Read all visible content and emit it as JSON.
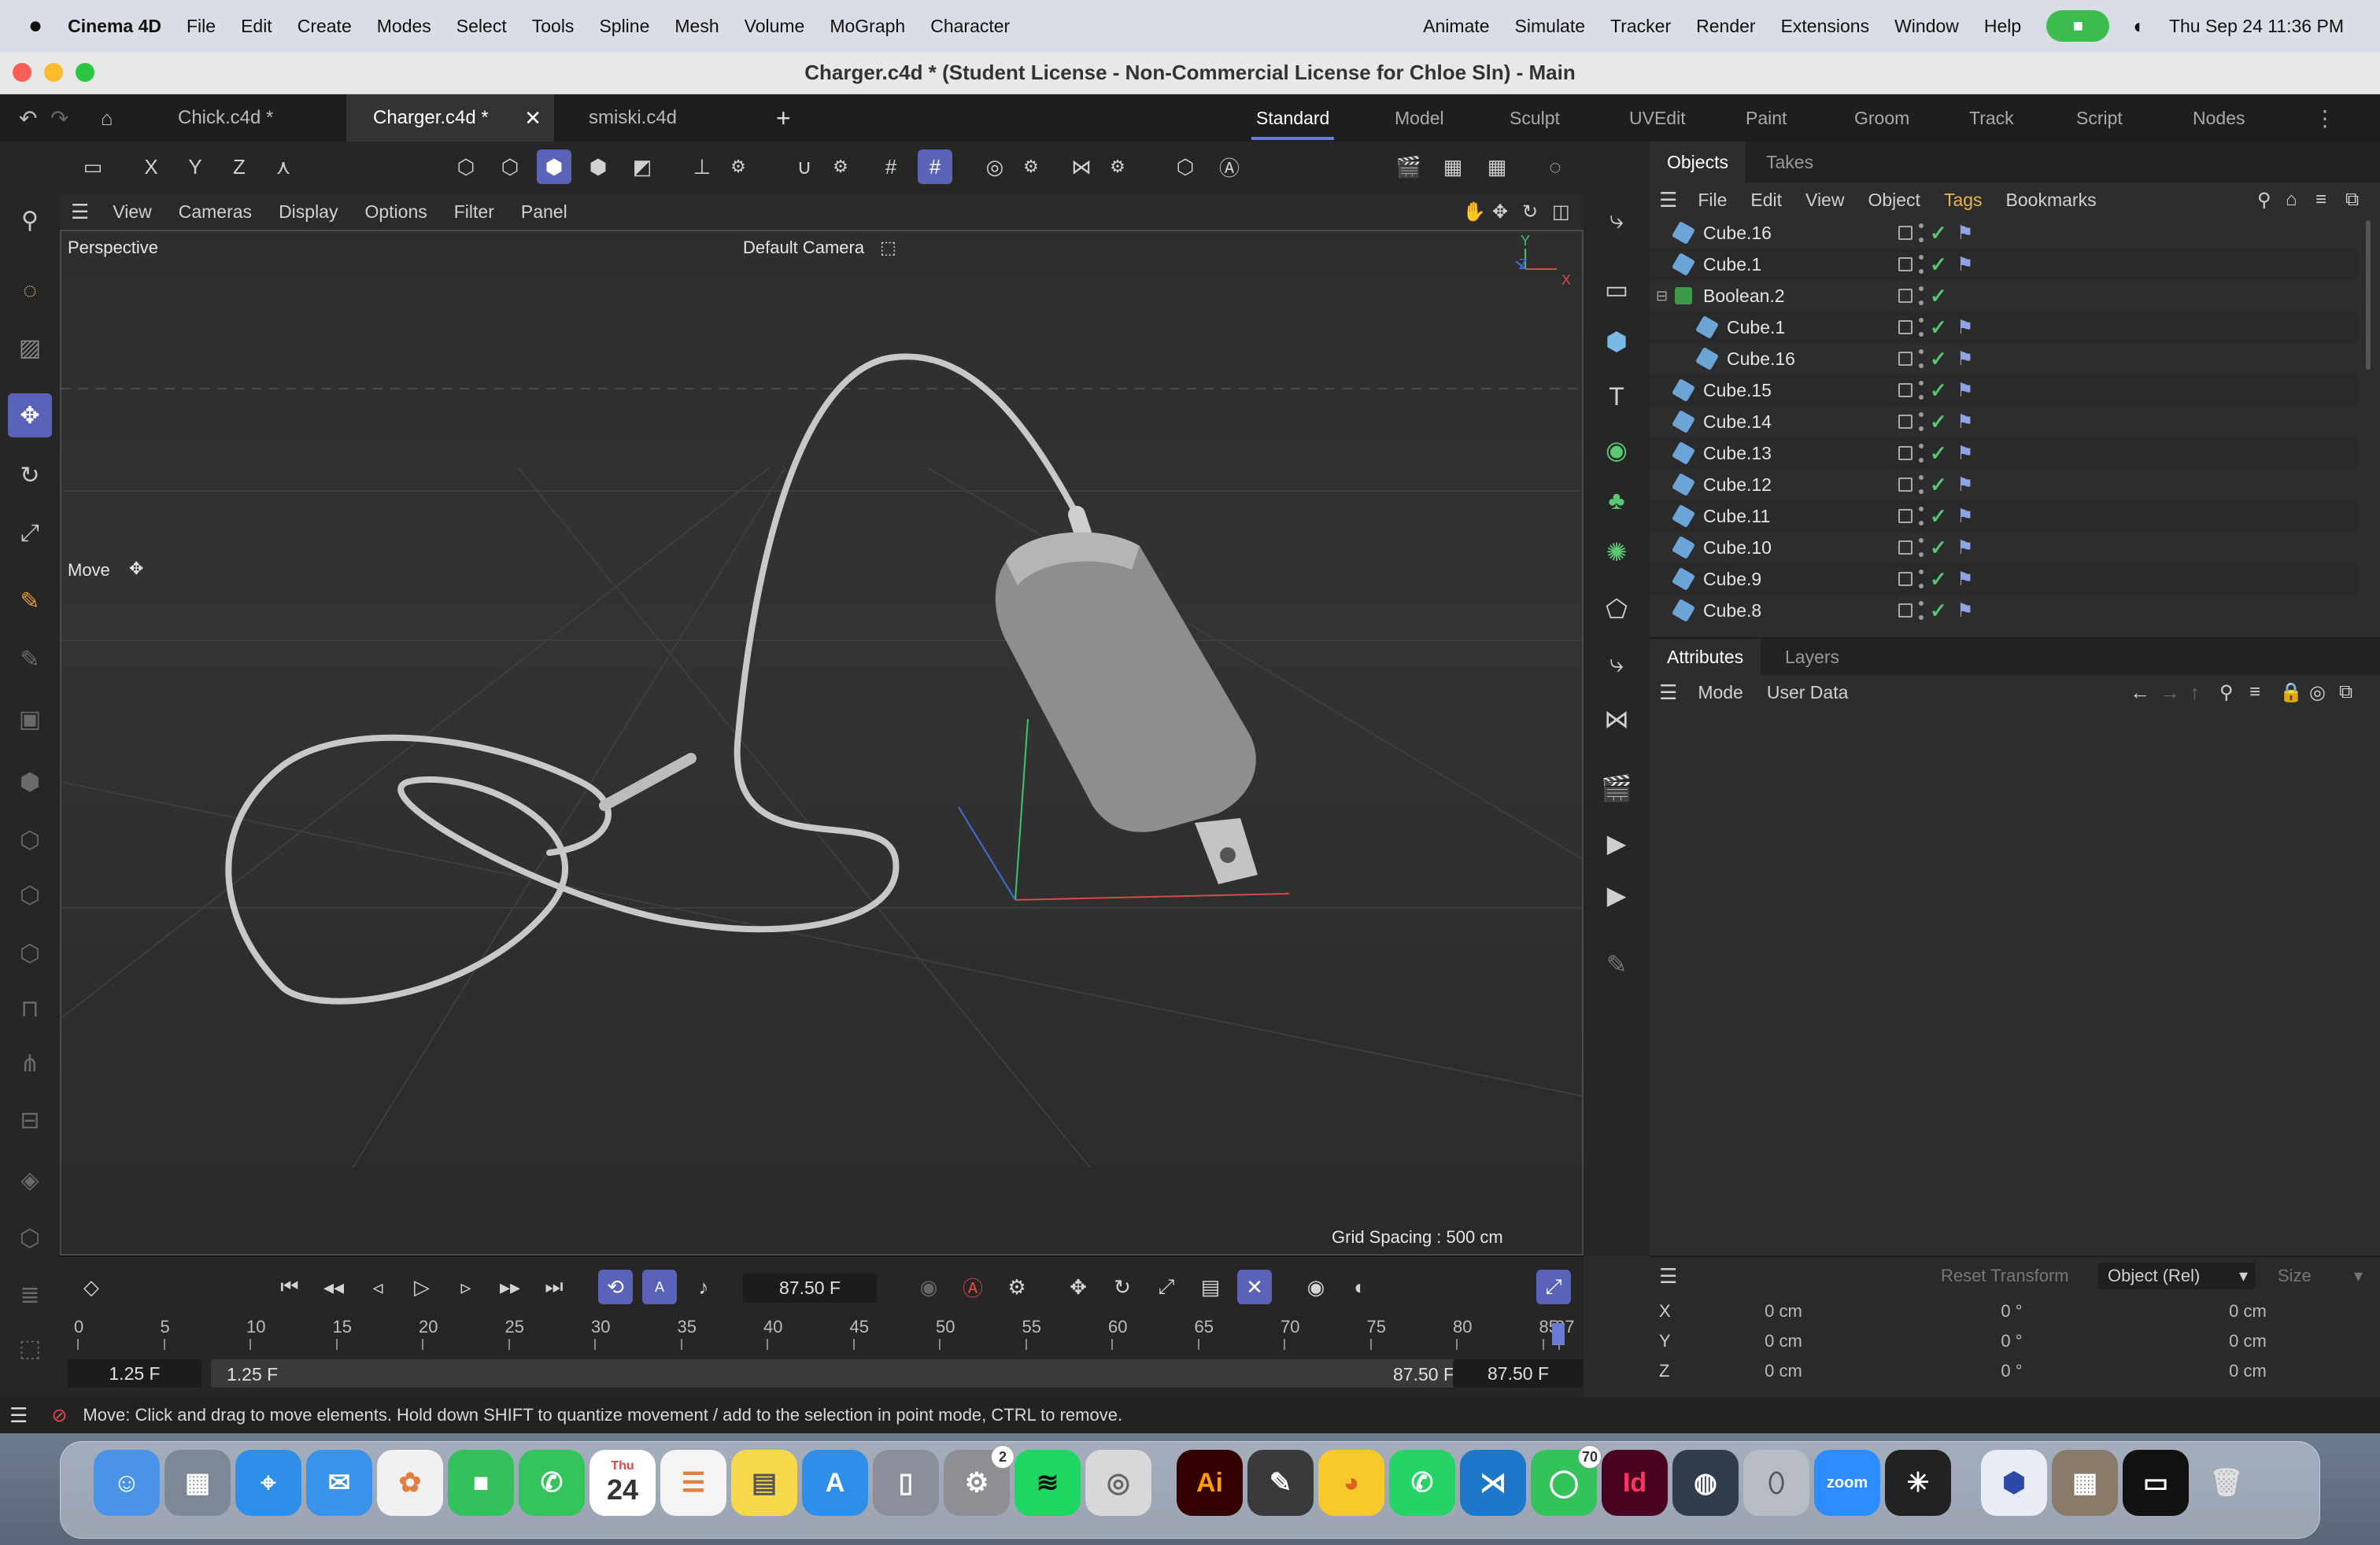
{
  "menubar": {
    "app": "Cinema 4D",
    "left_items": [
      "File",
      "Edit",
      "Create",
      "Modes",
      "Select",
      "Tools",
      "Spline",
      "Mesh",
      "Volume",
      "MoGraph",
      "Character"
    ],
    "right_items": [
      "Animate",
      "Simulate",
      "Tracker",
      "Render",
      "Extensions",
      "Window",
      "Help"
    ],
    "datetime": "Thu Sep 24  11:36 PM"
  },
  "window": {
    "title": "Charger.c4d * (Student License - Non-Commercial License for Chloe Sln) - Main"
  },
  "doc_tabs": [
    {
      "label": "Chick.c4d *"
    },
    {
      "label": "Charger.c4d *"
    },
    {
      "label": "smiski.c4d"
    }
  ],
  "layouts": [
    "Standard",
    "Model",
    "Sculpt",
    "UVEdit",
    "Paint",
    "Groom",
    "Track",
    "Script",
    "Nodes"
  ],
  "toolbar": {
    "axis_x": "X",
    "axis_y": "Y",
    "axis_z": "Z"
  },
  "viewport": {
    "menu": [
      "View",
      "Cameras",
      "Display",
      "Options",
      "Filter",
      "Panel"
    ],
    "projection": "Perspective",
    "camera": "Default Camera",
    "tool_label": "Move",
    "grid_spacing": "Grid Spacing : 500 cm",
    "axis_labels": {
      "x": "X",
      "y": "Y",
      "z": "Z"
    }
  },
  "objects_panel": {
    "tabs": [
      "Objects",
      "Takes"
    ],
    "menu": [
      "File",
      "Edit",
      "View",
      "Object",
      "Tags",
      "Bookmarks"
    ],
    "rows": [
      {
        "name": "Cube.16",
        "indent": 0,
        "type": "cube",
        "tag": true
      },
      {
        "name": "Cube.1",
        "indent": 0,
        "type": "cube",
        "tag": true
      },
      {
        "name": "Boolean.2",
        "indent": 0,
        "type": "boolean",
        "tag": false
      },
      {
        "name": "Cube.1",
        "indent": 1,
        "type": "cube",
        "tag": true
      },
      {
        "name": "Cube.16",
        "indent": 1,
        "type": "cube",
        "tag": true
      },
      {
        "name": "Cube.15",
        "indent": 0,
        "type": "cube",
        "tag": true
      },
      {
        "name": "Cube.14",
        "indent": 0,
        "type": "cube",
        "tag": true
      },
      {
        "name": "Cube.13",
        "indent": 0,
        "type": "cube",
        "tag": true
      },
      {
        "name": "Cube.12",
        "indent": 0,
        "type": "cube",
        "tag": true
      },
      {
        "name": "Cube.11",
        "indent": 0,
        "type": "cube",
        "tag": true
      },
      {
        "name": "Cube.10",
        "indent": 0,
        "type": "cube",
        "tag": true
      },
      {
        "name": "Cube.9",
        "indent": 0,
        "type": "cube",
        "tag": true
      },
      {
        "name": "Cube.8",
        "indent": 0,
        "type": "cube",
        "tag": true
      }
    ]
  },
  "attributes_panel": {
    "tabs": [
      "Attributes",
      "Layers"
    ],
    "menu": [
      "Mode",
      "User Data"
    ]
  },
  "coordinates": {
    "reset_label": "Reset Transform",
    "mode_select": "Object (Rel)",
    "size_label": "Size",
    "rows": [
      {
        "axis": "X",
        "pos": "0 cm",
        "rot": "0 °",
        "size": "0 cm"
      },
      {
        "axis": "Y",
        "pos": "0 cm",
        "rot": "0 °",
        "size": "0 cm"
      },
      {
        "axis": "Z",
        "pos": "0 cm",
        "rot": "0 °",
        "size": "0 cm"
      }
    ]
  },
  "timeline": {
    "current_frame": "87.50 F",
    "ruler": [
      "0",
      "5",
      "10",
      "15",
      "20",
      "25",
      "30",
      "35",
      "40",
      "45",
      "50",
      "55",
      "60",
      "65",
      "70",
      "75",
      "80",
      "85",
      "87"
    ],
    "range_start": "1.25 F",
    "range_start2": "1.25 F",
    "range_end": "87.50 F",
    "range_end2": "87.50 F"
  },
  "status": {
    "text": "Move: Click and drag to move elements. Hold down SHIFT to quantize movement / add to the selection in point mode, CTRL to remove."
  },
  "dock": {
    "calendar_month": "Thu",
    "calendar_day": "24",
    "settings_badge": "2",
    "messages_badge": "70",
    "illustrator": "Ai",
    "indesign": "Id",
    "zoom": "zoom"
  }
}
